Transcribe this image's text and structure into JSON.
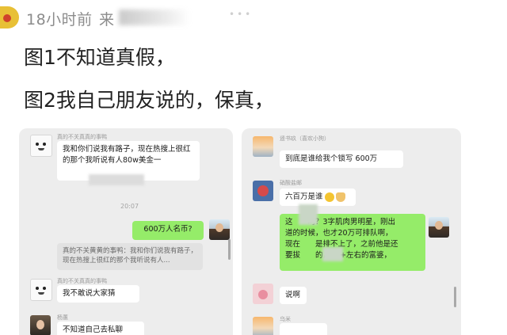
{
  "post": {
    "time": "18小时前",
    "name_partial": "来",
    "line1": "图1不知道真假，",
    "line2": "图2我自己朋友说的，保真，"
  },
  "chat1": {
    "msg1_name": "真的不关真真的事鸭",
    "msg1_text": "我和你们说我有路子，现在热搜上很红的那个我听说有人80w美金一",
    "timestamp": "20:07",
    "my_msg": "600万人名币?",
    "quote_name": "真的不关黄黄的事鸭",
    "quote_text": "真的不关黄黄的事鸭：我和你们说我有路子，现在热搜上很红的那个我听说有人...",
    "msg2_name": "真的不关真真的事鸭",
    "msg2_text": "我不敢说大家猜",
    "msg3_name": "杨蕙",
    "msg3_text": "不知道自己去私聊"
  },
  "chat2": {
    "msg1_name": "遥书玖（喜欢小狗）",
    "msg1_text": "到底是谁给我个锁写 600万",
    "msg2_name": "硝酸盐邮",
    "msg2_text": "六百万是谁",
    "green_lines": [
      "这　　呵？3字肌肉男明星，刚出",
      "道的时候，也才20万可排队啊，",
      "现在　　是排不上了，之前他是还",
      "要拔　　的，30+左右的富婆，"
    ],
    "msg3_text": "说啊",
    "msg4_name": "乌米"
  }
}
